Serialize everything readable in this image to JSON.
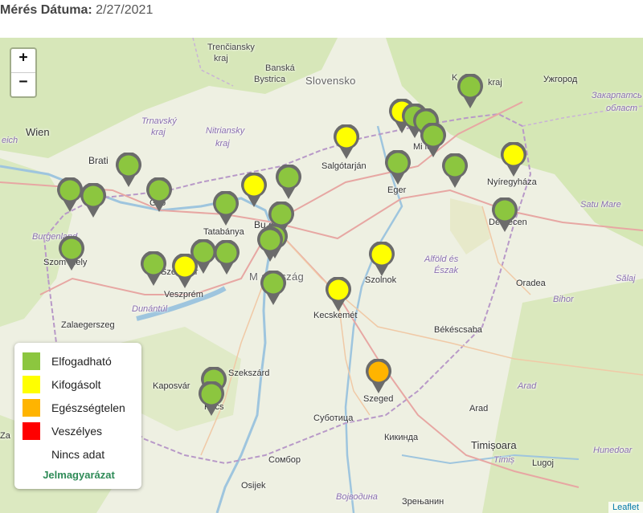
{
  "header": {
    "date_label": "Mérés Dátuma:",
    "date_value": "2/27/2021"
  },
  "zoom": {
    "in_label": "+",
    "out_label": "−"
  },
  "attribution": "Leaflet",
  "colors": {
    "good": "#8cc63f",
    "fair": "#ffff00",
    "unhealthy": "#ffb400",
    "dangerous": "#ff0000",
    "nodata": "#ffffff"
  },
  "legend": {
    "items": [
      {
        "label": "Elfogadható",
        "color": "#8cc63f"
      },
      {
        "label": "Kifogásolt",
        "color": "#ffff00"
      },
      {
        "label": "Egészségtelen",
        "color": "#ffb400"
      },
      {
        "label": "Veszélyes",
        "color": "#ff0000"
      },
      {
        "label": "Nincs adat",
        "color": "#ffffff"
      }
    ],
    "title": "Jelmagyarázat"
  },
  "places": {
    "trenciansky": "Trenčiansky",
    "kraj1": "kraj",
    "banska": "Banská",
    "bystrica": "Bystrica",
    "slovensko": "Slovensko",
    "kosicky": "K",
    "kraj2": "kraj",
    "uzhhorod": "Ужгород",
    "zakarpatska": "Закарпатсь",
    "oblast": "област",
    "trnavsky": "Trnavský",
    "kraj3": "kraj",
    "nitriansky": "Nitriansky",
    "kraj4": "kraj",
    "wien": "Wien",
    "reich": "eich",
    "bratislava": "Brati",
    "salgotarjan": "Salgótarján",
    "miskolc": "Mi lc",
    "eger": "Eger",
    "nyiregyhaza": "Nyíregyháza",
    "gyor": "Győ",
    "tatabanya": "Tatabánya",
    "budapest": "Bu est",
    "debrecen": "Debrecen",
    "satu_mare": "Satu Mare",
    "burgenland": "Burgenland",
    "szombathely": "Szom thely",
    "szekesfehervar": "Szék rvár",
    "magyarorszag": "M arország",
    "alfold": "Alföld és",
    "eszak": "Észak",
    "szolnok": "Szolnok",
    "oradea": "Oradea",
    "salaj": "Sălaj",
    "bihor": "Bihor",
    "veszprem": "Veszprém",
    "dunantul": "Dunántúl",
    "zalaegerszeg": "Zalaegerszeg",
    "kecskemet": "Kecskemét",
    "bekescsaba": "Békéscsaba",
    "szekszard": "Szekszárd",
    "kaposvar": "Kaposvár",
    "pecs": "Pécs",
    "szeged": "Szeged",
    "arad_region": "Arad",
    "arad": "Arad",
    "subotica": "Суботица",
    "kikinda": "Кикинда",
    "timisoara": "Timișoara",
    "hunedoara": "Hunedoar",
    "timis": "Timiș",
    "lugoj": "Lugoj",
    "sombor": "Сомбор",
    "osijek": "Osijek",
    "vojvodina": "Војводина",
    "zrenjanin": "Зрењанин",
    "za": "Za"
  },
  "markers": [
    {
      "color": "#8cc63f"
    },
    {
      "color": "#ffff00"
    },
    {
      "color": "#8cc63f"
    },
    {
      "color": "#8cc63f"
    },
    {
      "color": "#8cc63f"
    },
    {
      "color": "#ffff00"
    },
    {
      "color": "#8cc63f"
    },
    {
      "color": "#8cc63f"
    },
    {
      "color": "#ffff00"
    },
    {
      "color": "#8cc63f"
    },
    {
      "color": "#8cc63f"
    },
    {
      "color": "#8cc63f"
    },
    {
      "color": "#8cc63f"
    },
    {
      "color": "#8cc63f"
    },
    {
      "color": "#ffff00"
    },
    {
      "color": "#8cc63f"
    },
    {
      "color": "#8cc63f"
    },
    {
      "color": "#8cc63f"
    },
    {
      "color": "#8cc63f"
    },
    {
      "color": "#8cc63f"
    },
    {
      "color": "#8cc63f"
    },
    {
      "color": "#8cc63f"
    },
    {
      "color": "#ffff00"
    },
    {
      "color": "#8cc63f"
    },
    {
      "color": "#8cc63f"
    },
    {
      "color": "#8cc63f"
    },
    {
      "color": "#ffff00"
    },
    {
      "color": "#ffff00"
    },
    {
      "color": "#ffb400"
    },
    {
      "color": "#8cc63f"
    },
    {
      "color": "#8cc63f"
    }
  ]
}
